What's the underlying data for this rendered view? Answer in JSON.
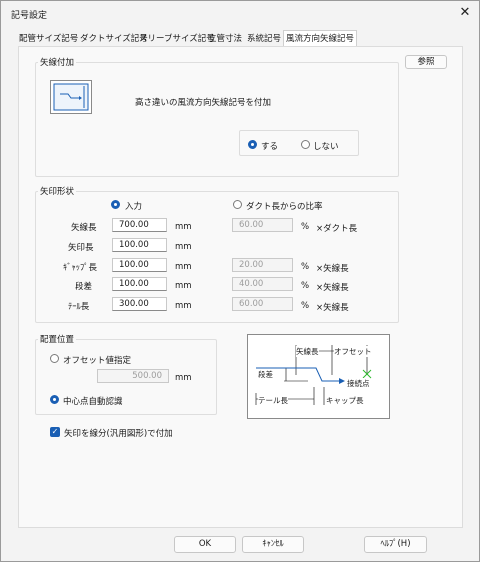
{
  "window": {
    "title": "記号設定",
    "close_glyph": "✕"
  },
  "tabs": [
    "配管サイズ記号",
    "ダクトサイズ記号",
    "スリーブサイズ記号",
    "立管寸法",
    "系統記号",
    "風流方向矢線記号"
  ],
  "reference_button": "参照",
  "arrow_group": {
    "title": "矢線付加",
    "description": "高さ違いの風流方向矢線記号を付加",
    "options": [
      "する",
      "しない"
    ],
    "selected": "する"
  },
  "shape_group": {
    "title": "矢印形状",
    "mode_input": "入力",
    "mode_ratio": "ダクト長からの比率",
    "mode_selected": "入力",
    "rows": [
      {
        "label": "矢線長",
        "value": "700.00",
        "unit": "mm",
        "ratio": "60.00",
        "ratio_unit": "%",
        "ratio_ref": "×ダクト長"
      },
      {
        "label": "矢印長",
        "value": "100.00",
        "unit": "mm"
      },
      {
        "label": "ｷﾞｬｯﾌﾟ長",
        "value": "100.00",
        "unit": "mm",
        "ratio": "20.00",
        "ratio_unit": "%",
        "ratio_ref": "×矢線長"
      },
      {
        "label": "段差",
        "value": "100.00",
        "unit": "mm",
        "ratio": "40.00",
        "ratio_unit": "%",
        "ratio_ref": "×矢線長"
      },
      {
        "label": "ﾃｰﾙ長",
        "value": "300.00",
        "unit": "mm",
        "ratio": "60.00",
        "ratio_unit": "%",
        "ratio_ref": "×矢線長"
      }
    ]
  },
  "position_group": {
    "title": "配置位置",
    "option_offset": "オフセット値指定",
    "offset_value": "500.00",
    "offset_unit": "mm",
    "option_center": "中心点自動認識",
    "selected": "中心点自動認識"
  },
  "diagram": {
    "label_arrow_length": "矢線長",
    "label_offset": "オフセット",
    "label_step": "段差",
    "label_connection": "接続点",
    "label_tail": "テール長",
    "label_gap": "キャップ長"
  },
  "checkbox": {
    "label": "矢印を線分(汎用図形)で付加",
    "checked": true
  },
  "footer": {
    "ok": "OK",
    "cancel": "ｷｬﾝｾﾙ",
    "help": "ﾍﾙﾌﾟ(H)"
  },
  "colors": {
    "accent": "#1a5fb4",
    "connection_mark": "#2db82d"
  }
}
